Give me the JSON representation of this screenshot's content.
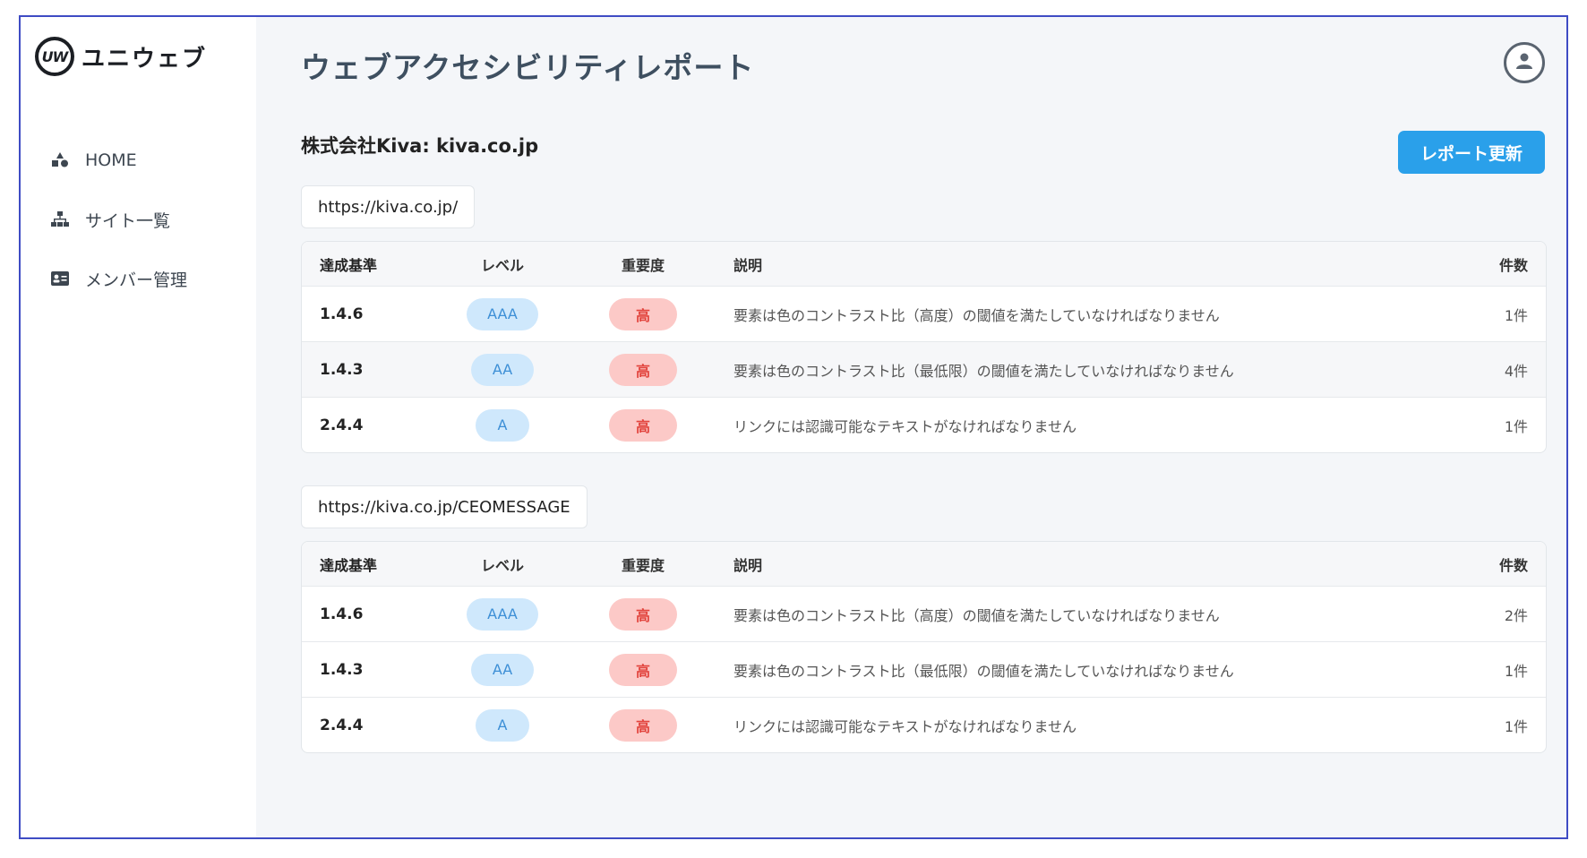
{
  "brand": {
    "logo_mark": "UW",
    "name": "ユニウェブ"
  },
  "nav": [
    {
      "label": "HOME",
      "icon": "home-icon"
    },
    {
      "label": "サイト一覧",
      "icon": "sitemap-icon"
    },
    {
      "label": "メンバー管理",
      "icon": "id-card-icon"
    }
  ],
  "header": {
    "title": "ウェブアクセシビリティレポート",
    "company": "株式会社Kiva: kiva.co.jp",
    "refresh_label": "レポート更新",
    "user_icon": "user-icon"
  },
  "columns": {
    "criterion": "達成基準",
    "level": "レベル",
    "severity": "重要度",
    "description": "説明",
    "count": "件数"
  },
  "reports": [
    {
      "url": "https://kiva.co.jp/",
      "rows": [
        {
          "criterion": "1.4.6",
          "level": "AAA",
          "severity": "高",
          "description": "要素は色のコントラスト比（高度）の閾値を満たしていなければなりません",
          "count": "1件"
        },
        {
          "criterion": "1.4.3",
          "level": "AA",
          "severity": "高",
          "description": "要素は色のコントラスト比（最低限）の閾値を満たしていなければなりません",
          "count": "4件"
        },
        {
          "criterion": "2.4.4",
          "level": "A",
          "severity": "高",
          "description": "リンクには認識可能なテキストがなければなりません",
          "count": "1件"
        }
      ]
    },
    {
      "url": "https://kiva.co.jp/CEOMESSAGE",
      "rows": [
        {
          "criterion": "1.4.6",
          "level": "AAA",
          "severity": "高",
          "description": "要素は色のコントラスト比（高度）の閾値を満たしていなければなりません",
          "count": "2件"
        },
        {
          "criterion": "1.4.3",
          "level": "AA",
          "severity": "高",
          "description": "要素は色のコントラスト比（最低限）の閾値を満たしていなければなりません",
          "count": "1件"
        },
        {
          "criterion": "2.4.4",
          "level": "A",
          "severity": "高",
          "description": "リンクには認識可能なテキストがなければなりません",
          "count": "1件"
        }
      ]
    }
  ],
  "colors": {
    "accent": "#2aa0ea",
    "level_pill_bg": "#cfe8fc",
    "level_pill_text": "#3d8fd6",
    "severity_pill_bg": "#fcc9c7",
    "severity_pill_text": "#e2453e"
  }
}
